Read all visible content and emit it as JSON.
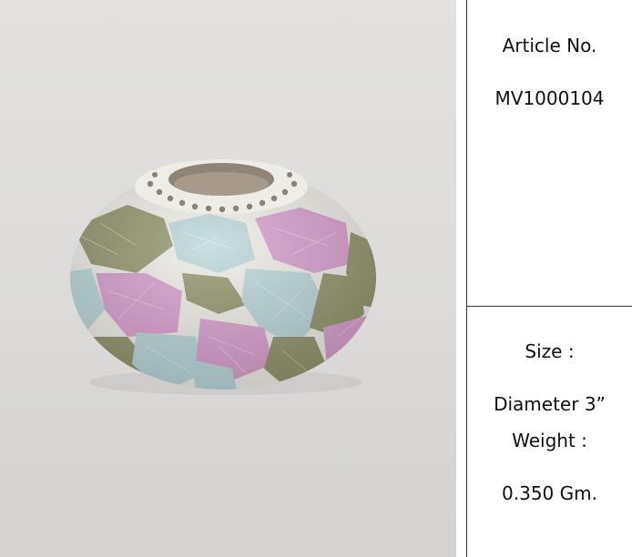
{
  "product_image": {
    "subject": "mosaic glass tealight holder",
    "colors": {
      "pink": "#d89bcb",
      "olive": "#8f9168",
      "ice_blue": "#b9d4d8",
      "grout": "#eeece6",
      "background": "#dedddb"
    }
  },
  "spec_table": {
    "article_label": "Article No.",
    "article_value": "MV1000104",
    "size_label": "Size :",
    "size_value": "Diameter 3”",
    "weight_label": "Weight :",
    "weight_value": "0.350 Gm."
  }
}
